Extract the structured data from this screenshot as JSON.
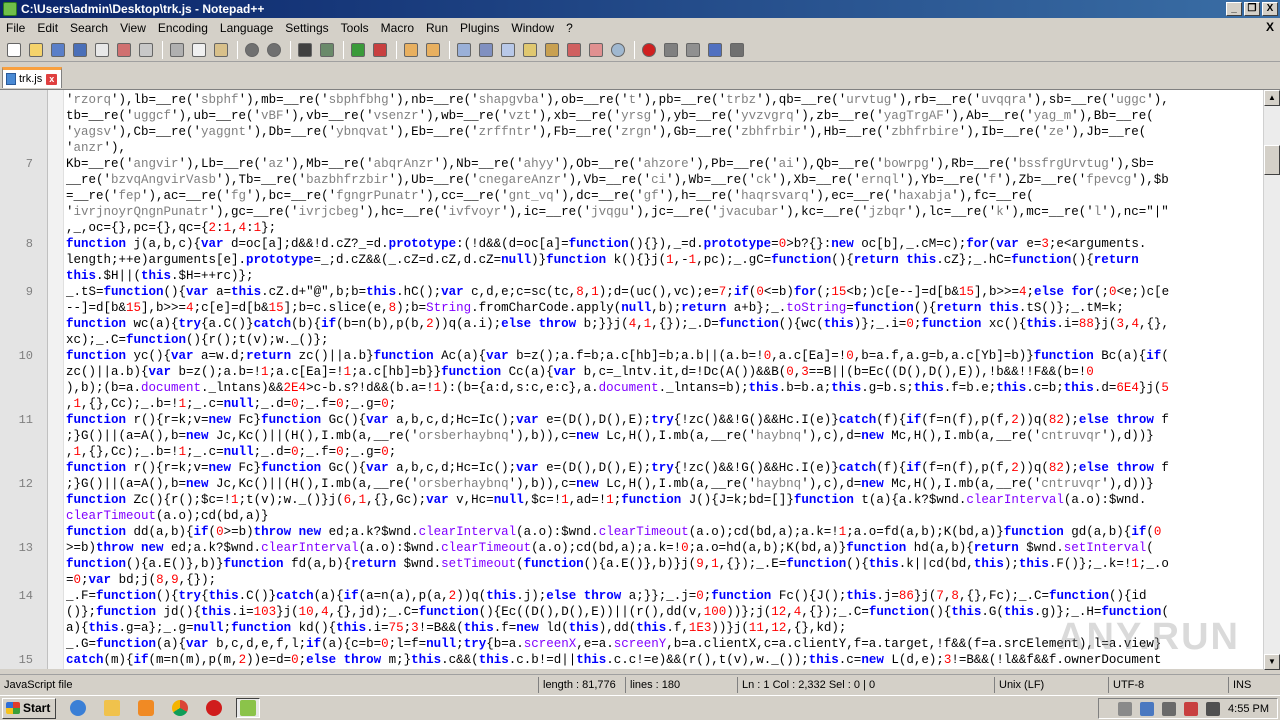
{
  "window": {
    "title": "C:\\Users\\admin\\Desktop\\trk.js - Notepad++",
    "buttons": [
      "_",
      "❒",
      "X"
    ]
  },
  "menu": [
    "File",
    "Edit",
    "Search",
    "View",
    "Encoding",
    "Language",
    "Settings",
    "Tools",
    "Macro",
    "Run",
    "Plugins",
    "Window",
    "?"
  ],
  "menu_close": "X",
  "tab": {
    "label": "trk.js",
    "close": "x"
  },
  "editor": {
    "lines": [
      {
        "n": "",
        "html": "'<span class=str>rzorq</span>'),lb=__re('<span class=str>sbphf</span>'),mb=__re('<span class=str>sbphfbhg</span>'),nb=__re('<span class=str>shapgvba</span>'),ob=__re('<span class=str>t</span>'),pb=__re('<span class=str>trbz</span>'),qb=__re('<span class=str>urvtug</span>'),rb=__re('<span class=str>uvqqra</span>'),sb=__re('<span class=str>uggc</span>'),"
      },
      {
        "n": "",
        "html": "tb=__re('<span class=str>uggcf</span>'),ub=__re('<span class=str>vBF</span>'),vb=__re('<span class=str>vsenzr</span>'),wb=__re('<span class=str>vzt</span>'),xb=__re('<span class=str>yrsg</span>'),yb=__re('<span class=str>yvzvgrq</span>'),zb=__re('<span class=str>yagTrgAF</span>'),Ab=__re('<span class=str>yag_m</span>'),Bb=__re("
      },
      {
        "n": "",
        "html": "'<span class=str>yagsv</span>'),Cb=__re('<span class=str>yaggnt</span>'),Db=__re('<span class=str>ybnqvat</span>'),Eb=__re('<span class=str>zrffntr</span>'),Fb=__re('<span class=str>zrgn</span>'),Gb=__re('<span class=str>zbhfrbir</span>'),Hb=__re('<span class=str>zbhfrbire</span>'),Ib=__re('<span class=str>ze</span>'),Jb=__re("
      },
      {
        "n": "",
        "html": "'<span class=str>anzr</span>'),"
      },
      {
        "n": "7",
        "html": "Kb=__re('<span class=str>angvir</span>'),Lb=__re('<span class=str>az</span>'),Mb=__re('<span class=str>abqrAnzr</span>'),Nb=__re('<span class=str>ahyy</span>'),Ob=__re('<span class=str>ahzore</span>'),Pb=__re('<span class=str>ai</span>'),Qb=__re('<span class=str>bowrpg</span>'),Rb=__re('<span class=str>bssfrgUrvtug</span>'),Sb="
      },
      {
        "n": "",
        "html": "__re('<span class=str>bzvqAngvirVasb</span>'),Tb=__re('<span class=str>bazbhfrzbir</span>'),Ub=__re('<span class=str>cnegareAnzr</span>'),Vb=__re('<span class=str>ci</span>'),Wb=__re('<span class=str>ck</span>'),Xb=__re('<span class=str>ernql</span>'),Yb=__re('<span class=str>f</span>'),Zb=__re('<span class=str>fpevcg</span>'),$b"
      },
      {
        "n": "",
        "html": "=__re('<span class=str>fep</span>'),ac=__re('<span class=str>fg</span>'),bc=__re('<span class=str>fgngrPunatr</span>'),cc=__re('<span class=str>gnt_vq</span>'),dc=__re('<span class=str>gf</span>'),h=__re('<span class=str>haqrsvarq</span>'),ec=__re('<span class=str>haxabja</span>'),fc=__re("
      },
      {
        "n": "",
        "html": "'<span class=str>ivrjnoyrQngnPunatr</span>'),gc=__re('<span class=str>ivrjcbeg</span>'),hc=__re('<span class=str>ivfvoyr</span>'),ic=__re('<span class=str>jvqgu</span>'),jc=__re('<span class=str>jvacubar</span>'),kc=__re('<span class=str>jzbqr</span>'),lc=__re('<span class=str>k</span>'),mc=__re('<span class=str>l</span>'),nc=\"|\""
      },
      {
        "n": "",
        "html": ",_,oc={},pc={},qc={<span class=num>2</span>:<span class=num>1</span>,<span class=num>4</span>:<span class=num>1</span>};"
      },
      {
        "n": "8",
        "html": "<span class=kw>function</span> j(a,b,c){<span class=kw>var</span> d=oc[a];d&amp;&amp;!d.cZ?_=d.<span class=kw>prototype</span>:(!d&amp;&amp;(d=oc[a]=<span class=kw>function</span>(){}),_=d.<span class=kw>prototype</span>=<span class=num>0</span>&gt;b?{}:<span class=kw>new</span> oc[b],_.cM=c);<span class=kw>for</span>(<span class=kw>var</span> e=<span class=num>3</span>;e&lt;arguments."
      },
      {
        "n": "",
        "html": "length;++e)arguments[e].<span class=kw>prototype</span>=_;d.cZ&amp;&amp;(_.cZ=d.cZ,d.cZ=<span class=kw>null</span>)}<span class=kw>function</span> k(){}j(<span class=num>1</span>,-<span class=num>1</span>,pc);_.gC=<span class=kw>function</span>(){<span class=kw>return this</span>.cZ};_.hC=<span class=kw>function</span>(){<span class=kw>return</span>"
      },
      {
        "n": "",
        "html": "<span class=kw>this</span>.$H||(<span class=kw>this</span>.$H=++rc)};"
      },
      {
        "n": "9",
        "html": "_.tS=<span class=kw>function</span>(){<span class=kw>var</span> a=<span class=kw>this</span>.cZ.d+\"@\",b;b=<span class=kw>this</span>.hC();<span class=kw>var</span> c,d,e;c=sc(tc,<span class=num>8</span>,<span class=num>1</span>);d=(uc(),vc);e=<span class=num>7</span>;<span class=kw>if</span>(<span class=num>0</span>&lt;=b)<span class=kw>for</span>(;<span class=num>15</span>&lt;b;)c[e--]=d[b&amp;<span class=num>15</span>],b&gt;&gt;=<span class=num>4</span>;<span class=kw>else for</span>(;<span class=num>0</span>&lt;e;)c[e"
      },
      {
        "n": "",
        "html": "--]=d[b&amp;<span class=num>15</span>],b&gt;&gt;=<span class=num>4</span>;c[e]=d[b&amp;<span class=num>15</span>];b=c.slice(e,<span class=num>8</span>);b=<span class=obj>String</span>.fromCharCode.apply(<span class=kw>null</span>,b);<span class=kw>return</span> a+b};_.<span class=obj>toString</span>=<span class=kw>function</span>(){<span class=kw>return this</span>.tS()};_.tM=k;"
      },
      {
        "n": "",
        "html": "<span class=kw>function</span> wc(a){<span class=kw>try</span>{a.C()}<span class=kw>catch</span>(b){<span class=kw>if</span>(b=n(b),p(b,<span class=num>2</span>))q(a.i);<span class=kw>else throw</span> b;}}j(<span class=num>4</span>,<span class=num>1</span>,{});_.D=<span class=kw>function</span>(){wc(<span class=kw>this</span>)};_.i=<span class=num>0</span>;<span class=kw>function</span> xc(){<span class=kw>this</span>.i=<span class=num>88</span>}j(<span class=num>3</span>,<span class=num>4</span>,{},"
      },
      {
        "n": "",
        "html": "xc);_.C=<span class=kw>function</span>(){r();t(v);w._()};"
      },
      {
        "n": "10",
        "html": "<span class=kw>function</span> yc(){<span class=kw>var</span> a=w.d;<span class=kw>return</span> zc()||a.b}<span class=kw>function</span> Ac(a){<span class=kw>var</span> b=z();a.f=b;a.c[hb]=b;a.b||(a.b=!<span class=num>0</span>,a.c[Ea]=!<span class=num>0</span>,b=a.f,a.g=b,a.c[Yb]=b)}<span class=kw>function</span> Bc(a){<span class=kw>if</span>("
      },
      {
        "n": "",
        "html": "zc()||a.b){<span class=kw>var</span> b=z();a.b=!<span class=num>1</span>;a.c[Ea]=!<span class=num>1</span>;a.c[hb]=b}}<span class=kw>function</span> Cc(a){<span class=kw>var</span> b,c=_lntv.it,d=!Dc(A())&amp;&amp;B(<span class=num>0</span>,<span class=num>3</span>==B||(b=Ec((D(),D(),E)),!b&amp;&amp;!!F&amp;&amp;(b=!<span class=num>0</span>"
      },
      {
        "n": "",
        "html": "),b);(b=a.<span class=obj>document</span>._lntans)&amp;&amp;<span class=num>2E4</span>&gt;c-b.s?!d&amp;&amp;(b.a=!<span class=num>1</span>):(b={a:d,s:c,e:c},a.<span class=obj>document</span>._lntans=b);<span class=kw>this</span>.b=b.a;<span class=kw>this</span>.g=b.s;<span class=kw>this</span>.f=b.e;<span class=kw>this</span>.c=b;<span class=kw>this</span>.d=<span class=num>6E4</span>}j(<span class=num>5</span>"
      },
      {
        "n": "",
        "html": ",<span class=num>1</span>,{},Cc);_.b=!<span class=num>1</span>;_.c=<span class=kw>null</span>;_.d=<span class=num>0</span>;_.f=<span class=num>0</span>;_.g=<span class=num>0</span>;"
      },
      {
        "n": "11",
        "html": "<span class=kw>function</span> r(){r=k;v=<span class=kw>new</span> Fc}<span class=kw>function</span> Gc(){<span class=kw>var</span> a,b,c,d;Hc=Ic();<span class=kw>var</span> e=(D(),D(),E);<span class=kw>try</span>{!zc()&amp;&amp;!G()&amp;&amp;Hc.I(e)}<span class=kw>catch</span>(f){<span class=kw>if</span>(f=n(f),p(f,<span class=num>2</span>))q(<span class=num>82</span>);<span class=kw>else throw</span> f"
      },
      {
        "n": "",
        "html": ";}G()||(a=A(),b=<span class=kw>new</span> Jc,Kc()||(H(),I.mb(a,__re('<span class=str>orsberhaybnq</span>'),b)),c=<span class=kw>new</span> Lc,H(),I.mb(a,__re('<span class=str>haybnq</span>'),c),d=<span class=kw>new</span> Mc,H(),I.mb(a,__re('<span class=str>cntruvqr</span>'),d))}"
      },
      {
        "n": "",
        "html": ",<span class=num>1</span>,{},Cc);_.b=!<span class=num>1</span>;_.c=<span class=kw>null</span>;_.d=<span class=num>0</span>;_.f=<span class=num>0</span>;_.g=<span class=num>0</span>;"
      },
      {
        "n": "",
        "html": "<span class=kw>function</span> r(){r=k;v=<span class=kw>new</span> Fc}<span class=kw>function</span> Gc(){<span class=kw>var</span> a,b,c,d;Hc=Ic();<span class=kw>var</span> e=(D(),D(),E);<span class=kw>try</span>{!zc()&amp;&amp;!G()&amp;&amp;Hc.I(e)}<span class=kw>catch</span>(f){<span class=kw>if</span>(f=n(f),p(f,<span class=num>2</span>))q(<span class=num>82</span>);<span class=kw>else throw</span> f"
      },
      {
        "n": "12",
        "html": ";}G()||(a=A(),b=<span class=kw>new</span> Jc,Kc()||(H(),I.mb(a,__re('<span class=str>orsberhaybnq</span>'),b)),c=<span class=kw>new</span> Lc,H(),I.mb(a,__re('<span class=str>haybnq</span>'),c),d=<span class=kw>new</span> Mc,H(),I.mb(a,__re('<span class=str>cntruvqr</span>'),d))}"
      },
      {
        "n": "",
        "html": "<span class=kw>function</span> Zc(){r();$c=!<span class=num>1</span>;t(v);w._()}j(<span class=num>6</span>,<span class=num>1</span>,{},Gc);<span class=kw>var</span> v,Hc=<span class=kw>null</span>,$c=!<span class=num>1</span>,ad=!<span class=num>1</span>;<span class=kw>function</span> J(){J=k;bd=[]}<span class=kw>function</span> t(a){a.k?$wnd.<span class=obj>clearInterval</span>(a.o):$wnd."
      },
      {
        "n": "",
        "html": "<span class=obj>clearTimeout</span>(a.o);cd(bd,a)}"
      },
      {
        "n": "",
        "html": "<span class=kw>function</span> dd(a,b){<span class=kw>if</span>(<span class=num>0</span>&gt;=b)<span class=kw>throw new</span> ed;a.k?$wnd.<span class=obj>clearInterval</span>(a.o):$wnd.<span class=obj>clearTimeout</span>(a.o);cd(bd,a);a.k=!<span class=num>1</span>;a.o=fd(a,b);K(bd,a)}<span class=kw>function</span> gd(a,b){<span class=kw>if</span>(<span class=num>0</span>"
      },
      {
        "n": "13",
        "html": "&gt;=b)<span class=kw>throw new</span> ed;a.k?$wnd.<span class=obj>clearInterval</span>(a.o):$wnd.<span class=obj>clearTimeout</span>(a.o);cd(bd,a);a.k=!<span class=num>0</span>;a.o=hd(a,b);K(bd,a)}<span class=kw>function</span> hd(a,b){<span class=kw>return</span> $wnd.<span class=obj>setInterval</span>("
      },
      {
        "n": "",
        "html": "<span class=kw>function</span>(){a.E()},b)}<span class=kw>function</span> fd(a,b){<span class=kw>return</span> $wnd.<span class=obj>setTimeout</span>(<span class=kw>function</span>(){a.E()},b)}j(<span class=num>9</span>,<span class=num>1</span>,{});_.E=<span class=kw>function</span>(){<span class=kw>this</span>.k||cd(bd,<span class=kw>this</span>);<span class=kw>this</span>.F()};_.k=!<span class=num>1</span>;_.o"
      },
      {
        "n": "",
        "html": "=<span class=num>0</span>;<span class=kw>var</span> bd;j(<span class=num>8</span>,<span class=num>9</span>,{});"
      },
      {
        "n": "14",
        "html": "_.F=<span class=kw>function</span>(){<span class=kw>try</span>{<span class=kw>this</span>.C()}<span class=kw>catch</span>(a){<span class=kw>if</span>(a=n(a),p(a,<span class=num>2</span>))q(<span class=kw>this</span>.j);<span class=kw>else throw</span> a;}};_.j=<span class=num>0</span>;<span class=kw>function</span> Fc(){J();<span class=kw>this</span>.j=<span class=num>86</span>}j(<span class=num>7</span>,<span class=num>8</span>,{},Fc);_.C=<span class=kw>function</span>(){id"
      },
      {
        "n": "",
        "html": "()};<span class=kw>function</span> jd(){<span class=kw>this</span>.i=<span class=num>103</span>}j(<span class=num>10</span>,<span class=num>4</span>,{},jd);_.C=<span class=kw>function</span>(){Ec((D(),D(),E))||(r(),dd(v,<span class=num>100</span>))};j(<span class=num>12</span>,<span class=num>4</span>,{});_.C=<span class=kw>function</span>(){<span class=kw>this</span>.G(<span class=kw>this</span>.g)};_.H=<span class=kw>function</span>("
      },
      {
        "n": "",
        "html": "a){<span class=kw>this</span>.g=a};_.g=<span class=kw>null</span>;<span class=kw>function</span> kd(){<span class=kw>this</span>.i=<span class=num>75</span>;<span class=num>3</span>!=B&amp;&amp;(<span class=kw>this</span>.f=<span class=kw>new</span> ld(<span class=kw>this</span>),dd(<span class=kw>this</span>.f,<span class=num>1E3</span>))}j(<span class=num>11</span>,<span class=num>12</span>,{},kd);"
      },
      {
        "n": "",
        "html": "_.G=<span class=kw>function</span>(a){<span class=kw>var</span> b,c,d,e,f,l;<span class=kw>if</span>(a){c=b=<span class=num>0</span>;l=f=<span class=kw>null</span>;<span class=kw>try</span>{b=a.<span class=obj>screenX</span>,e=a.<span class=obj>screenY</span>,b=a.clientX,c=a.clientY,f=a.target,!f&amp;&amp;(f=a.srcElement),l=a.view}"
      },
      {
        "n": "15",
        "html": "<span class=kw>catch</span>(m){<span class=kw>if</span>(m=n(m),p(m,<span class=num>2</span>))e=d=<span class=num>0</span>;<span class=kw>else throw</span> m;}<span class=kw>this</span>.c&amp;&amp;(<span class=kw>this</span>.c.b!=d||<span class=kw>this</span>.c.c!=e)&amp;&amp;(r(),t(v),w._());<span class=kw>this</span>.c=<span class=kw>new</span> L(d,e);<span class=num>3</span>!=B&amp;&amp;(!l&amp;&amp;f&amp;&amp;f.ownerDocument"
      }
    ]
  },
  "watermark": "ANY.RUN",
  "status": {
    "language": "JavaScript file",
    "length": "length : 81,776",
    "lines": "lines : 180",
    "position": "Ln : 1    Col : 2,332    Sel : 0 | 0",
    "eol": "Unix (LF)",
    "encoding": "UTF-8",
    "mode": "INS"
  },
  "taskbar": {
    "start": "Start",
    "time": "4:55 PM"
  }
}
